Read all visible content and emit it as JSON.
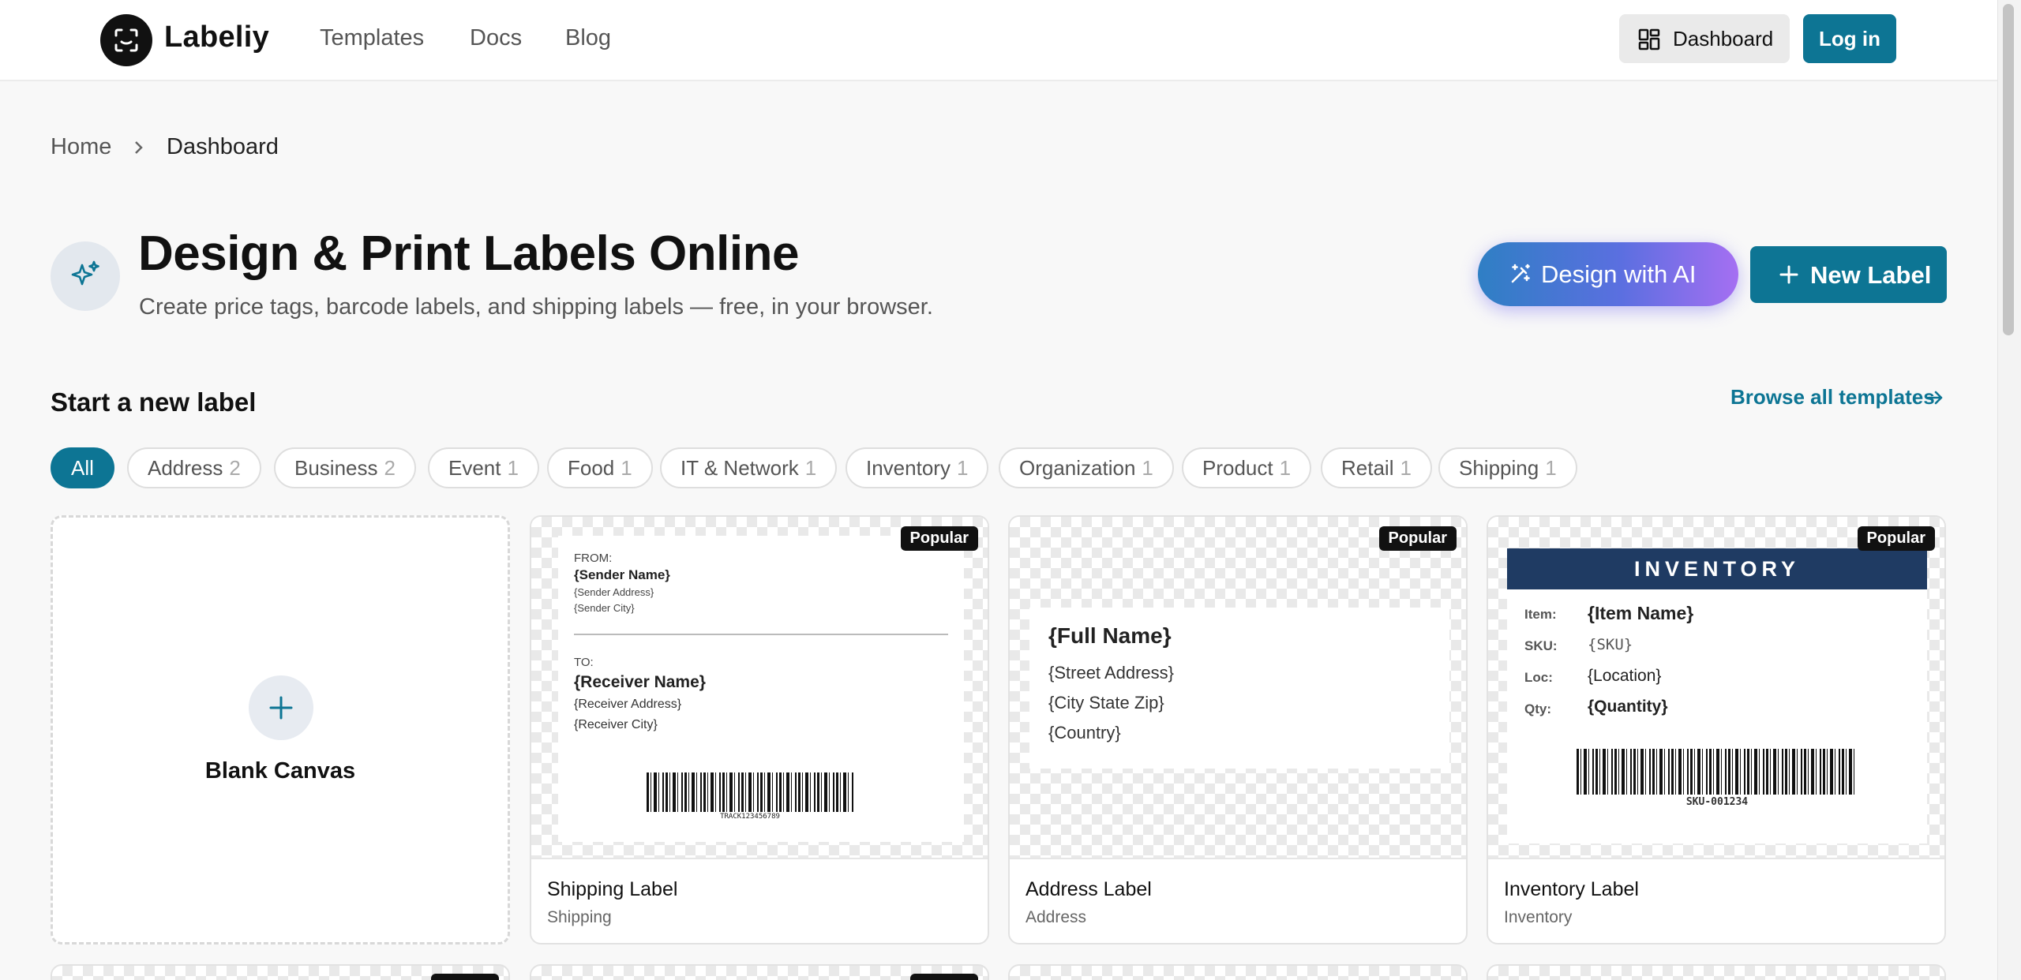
{
  "header": {
    "brand": "Labeliy",
    "nav": [
      "Templates",
      "Docs",
      "Blog"
    ],
    "dashboard_label": "Dashboard",
    "login_label": "Log in"
  },
  "breadcrumb": {
    "home": "Home",
    "current": "Dashboard"
  },
  "hero": {
    "title": "Design & Print Labels Online",
    "subtitle": "Create price tags, barcode labels, and shipping labels — free, in your browser.",
    "ai_button": "Design with AI",
    "new_button": "New Label"
  },
  "section": {
    "title": "Start a new label",
    "browse_link": "Browse all templates"
  },
  "filters": [
    {
      "label": "All",
      "count": ""
    },
    {
      "label": "Address",
      "count": "2"
    },
    {
      "label": "Business",
      "count": "2"
    },
    {
      "label": "Event",
      "count": "1"
    },
    {
      "label": "Food",
      "count": "1"
    },
    {
      "label": "IT & Network",
      "count": "1"
    },
    {
      "label": "Inventory",
      "count": "1"
    },
    {
      "label": "Organization",
      "count": "1"
    },
    {
      "label": "Product",
      "count": "1"
    },
    {
      "label": "Retail",
      "count": "1"
    },
    {
      "label": "Shipping",
      "count": "1"
    }
  ],
  "blank_card": {
    "label": "Blank Canvas"
  },
  "cards": [
    {
      "name": "Shipping Label",
      "category": "Shipping",
      "badge": "Popular"
    },
    {
      "name": "Address Label",
      "category": "Address",
      "badge": "Popular"
    },
    {
      "name": "Inventory Label",
      "category": "Inventory",
      "badge": "Popular"
    }
  ],
  "shipping_preview": {
    "from": "FROM:",
    "sender_name": "{Sender Name}",
    "sender_address": "{Sender Address}",
    "sender_city": "{Sender City}",
    "to": "TO:",
    "receiver_name": "{Receiver Name}",
    "receiver_address": "{Receiver Address}",
    "receiver_city": "{Receiver City}",
    "tracking": "TRACK123456789"
  },
  "address_preview": {
    "full_name": "{Full Name}",
    "street": "{Street Address}",
    "city": "{City State Zip}",
    "country": "{Country}"
  },
  "inventory_preview": {
    "header": "INVENTORY",
    "item_label": "Item:",
    "item_value": "{Item Name}",
    "sku_label": "SKU:",
    "sku_value": "{SKU}",
    "loc_label": "Loc:",
    "loc_value": "{Location}",
    "qty_label": "Qty:",
    "qty_value": "{Quantity}",
    "barcode_text": "SKU-001234"
  },
  "colors": {
    "accent": "#0d7594",
    "inventory_header": "#1f3b63"
  }
}
